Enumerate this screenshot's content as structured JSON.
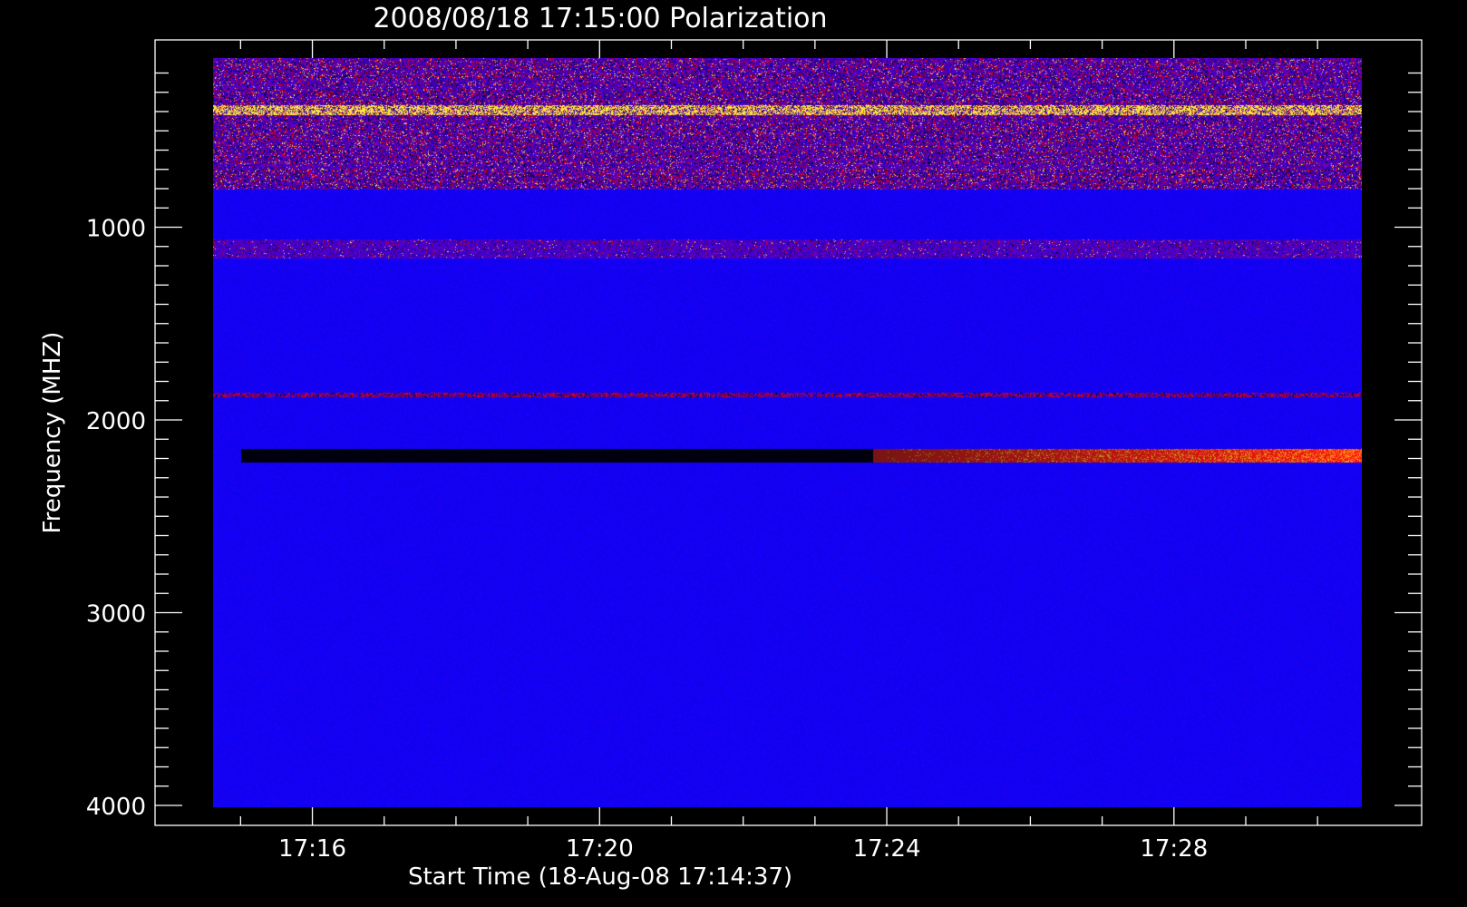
{
  "chart_data": {
    "type": "heatmap",
    "title": "2008/08/18 17:15:00 Polarization",
    "xlabel": "Start Time (18-Aug-08 17:14:37)",
    "ylabel": "Frequency (MHZ)",
    "x_tick_labels": [
      "17:16",
      "17:20",
      "17:24",
      "17:28"
    ],
    "y_tick_labels": [
      "1000",
      "2000",
      "3000",
      "4000"
    ],
    "x_range": [
      "17:14:37",
      "17:30:37"
    ],
    "y_range": [
      100,
      4000
    ],
    "y_direction": "increasing-downward",
    "colormap": [
      "#000000",
      "#0000ff",
      "#ff0000",
      "#ffff80"
    ],
    "background_color": "#0000ff",
    "grid": false,
    "features": [
      {
        "kind": "bursty-band",
        "freq_range_mhz": [
          120,
          800
        ],
        "intensity": "high"
      },
      {
        "kind": "bright-line",
        "freq_mhz": 390,
        "color": "#ffff66"
      },
      {
        "kind": "bursty-band",
        "freq_range_mhz": [
          1060,
          1160
        ],
        "intensity": "medium"
      },
      {
        "kind": "red-line",
        "freq_mhz": 1870,
        "time_range": [
          "17:15:00",
          "17:30:37"
        ]
      },
      {
        "kind": "dark-band",
        "freq_range_mhz": [
          2150,
          2220
        ],
        "time_range": [
          "17:15:00",
          "17:23:48"
        ]
      },
      {
        "kind": "red-band",
        "freq_range_mhz": [
          2150,
          2220
        ],
        "time_range": [
          "17:23:48",
          "17:30:37"
        ]
      }
    ]
  }
}
